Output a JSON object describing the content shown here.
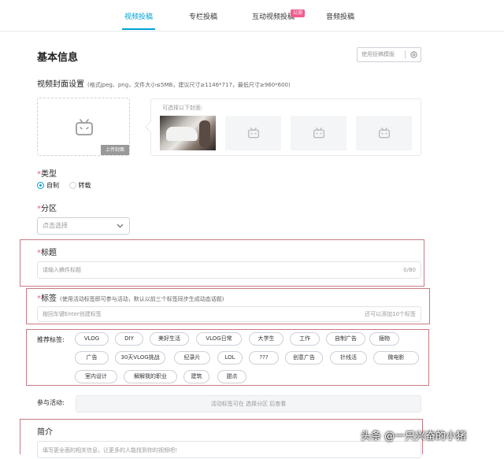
{
  "tabs": [
    {
      "label": "视频投稿",
      "active": true
    },
    {
      "label": "专栏投稿",
      "active": false
    },
    {
      "label": "互动视频投稿",
      "active": false,
      "badge": "公测"
    },
    {
      "label": "音频投稿",
      "active": false
    }
  ],
  "section": {
    "title": "基本信息",
    "template_button": "使用投稿模版"
  },
  "cover": {
    "title": "视频封面设置",
    "hint": "(格式jpeg、png，文件大小≤5MB，建议尺寸≥1146*717，最低尺寸≥960*600)",
    "upload_label": "上传封面",
    "suggest_hint": "可选择以下封面:"
  },
  "type": {
    "label": "类型",
    "options": [
      "自制",
      "转载"
    ],
    "selected": "自制"
  },
  "category": {
    "label": "分区",
    "placeholder": "点击选择"
  },
  "title_field": {
    "label": "标题",
    "placeholder": "请输入稿件标题",
    "counter": "0/80"
  },
  "tags_field": {
    "label": "标签",
    "hint": "(使用活动标签即可参与活动，默认以前三个标签同步生成动态话题)",
    "placeholder": "按回车键Enter创建标签",
    "remaining": "还可以添加10个标签"
  },
  "recommended": {
    "label": "推荐标签:",
    "tags": [
      "VLOG",
      "DIY",
      "美好生活",
      "VLOG日常",
      "大学生",
      "工作",
      "自制广告",
      "插物",
      "广告",
      "30天VLOG挑战",
      "纪录片",
      "LOL",
      "???",
      "创意广告",
      "针线活",
      "微电影",
      "室内设计",
      "解解我的职业",
      "建筑",
      "甜点"
    ]
  },
  "activity": {
    "label": "参与活动:",
    "text": "活动标签可在 选择分区 后查看"
  },
  "intro": {
    "label": "简介",
    "placeholder": "填写更全面的相关信息，让更多的人能找到你的视频吧!"
  },
  "watermark": "头条 @一只兴奋的小猪",
  "colors": {
    "accent": "#00a1d6",
    "required": "#f45a8d",
    "annotation": "#c97a84"
  }
}
